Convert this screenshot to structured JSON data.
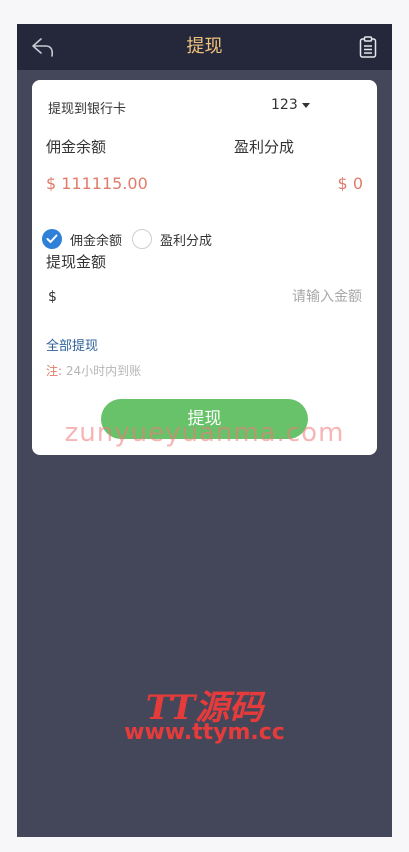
{
  "header": {
    "title": "提现",
    "back_icon": "back-arrow-icon",
    "record_icon": "clipboard-icon"
  },
  "form": {
    "bank_label": "提现到银行卡",
    "bank_selected": "123",
    "commission_label": "佣金余额",
    "profit_label": "盈利分成",
    "commission_value": "$ 111115.00",
    "profit_value": "$ 0",
    "radio_options": [
      {
        "label": "佣金余额",
        "checked": true
      },
      {
        "label": "盈利分成",
        "checked": false
      }
    ],
    "amount_label": "提现金额",
    "currency_symbol": "$",
    "amount_placeholder": "请输入金额",
    "withdraw_all": "全部提现",
    "note_prefix": "注:",
    "note_text": "24小时内到账",
    "submit_label": "提现"
  },
  "watermarks": {
    "site": "zunyueyuanma.com",
    "brand": "TT源码",
    "brand_url": "www.ttym.cc"
  },
  "colors": {
    "header_bg": "#25283a",
    "page_bg": "#44475a",
    "accent_gold": "#f1c27d",
    "value_red": "#e07b6a",
    "button_green": "#67c26a",
    "radio_blue": "#2f80d8"
  }
}
